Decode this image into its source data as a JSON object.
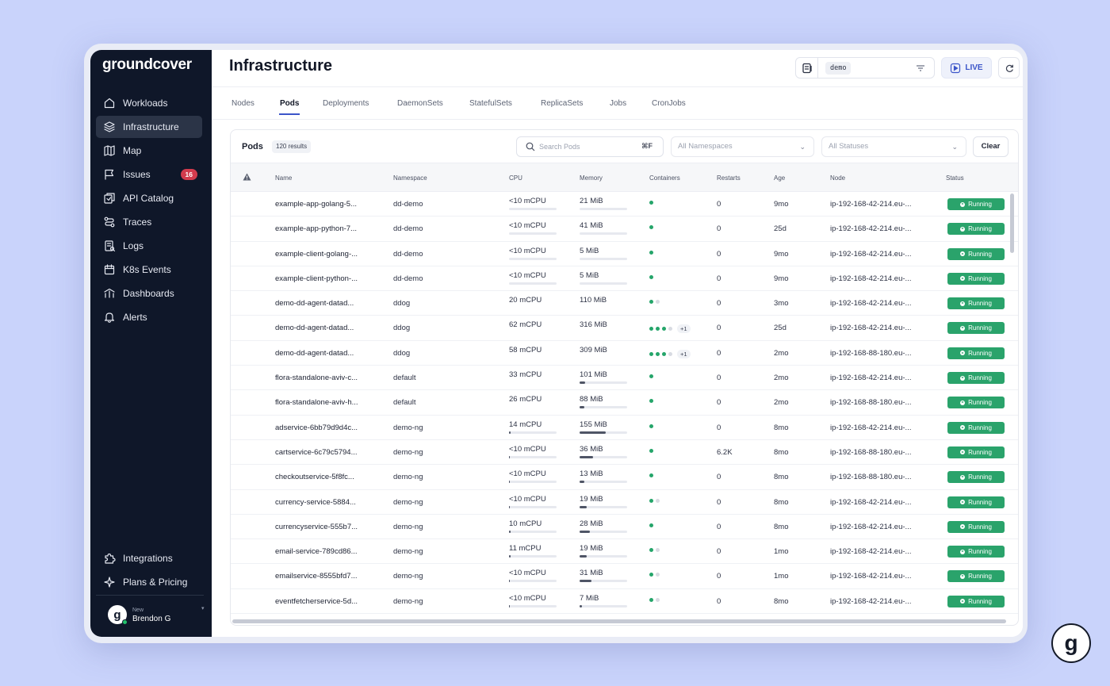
{
  "app": {
    "brand": "groundcover",
    "page_title": "Infrastructure"
  },
  "sidebar": {
    "items": [
      {
        "label": "Workloads",
        "icon": "home-icon"
      },
      {
        "label": "Infrastructure",
        "icon": "layers-icon",
        "active": true
      },
      {
        "label": "Map",
        "icon": "map-icon"
      },
      {
        "label": "Issues",
        "icon": "flag-icon",
        "badge": "16"
      },
      {
        "label": "API Catalog",
        "icon": "api-catalog-icon"
      },
      {
        "label": "Traces",
        "icon": "traces-icon"
      },
      {
        "label": "Logs",
        "icon": "logs-icon"
      },
      {
        "label": "K8s Events",
        "icon": "calendar-icon"
      },
      {
        "label": "Dashboards",
        "icon": "dashboards-icon"
      },
      {
        "label": "Alerts",
        "icon": "bell-icon"
      }
    ],
    "bottom_items": [
      {
        "label": "Integrations",
        "icon": "puzzle-icon"
      },
      {
        "label": "Plans & Pricing",
        "icon": "sparkle-icon"
      }
    ],
    "user": {
      "initial": "g",
      "tag": "New",
      "name": "Brendon G"
    }
  },
  "topbar": {
    "namespace_chip": "demo",
    "live_label": "LIVE"
  },
  "tabs": [
    "Nodes",
    "Pods",
    "Deployments",
    "DaemonSets",
    "StatefulSets",
    "ReplicaSets",
    "Jobs",
    "CronJobs"
  ],
  "active_tab": "Pods",
  "panel": {
    "title": "Pods",
    "results": "120 results",
    "search_placeholder": "Search Pods",
    "search_shortcut": "⌘F",
    "namespaces_placeholder": "All Namespaces",
    "statuses_placeholder": "All Statuses",
    "clear_label": "Clear"
  },
  "table": {
    "columns": [
      "Name",
      "Namespace",
      "CPU",
      "Memory",
      "Containers",
      "Restarts",
      "Age",
      "Node",
      "Status"
    ],
    "rows": [
      {
        "name": "example-app-golang-5...",
        "namespace": "dd-demo",
        "cpu": "<10 mCPU",
        "cpu_pct": 0,
        "memory": "21 MiB",
        "mem_pct": 0,
        "containers": [
          1
        ],
        "plus": "",
        "restarts": "0",
        "age": "9mo",
        "node": "ip-192-168-42-214.eu-...",
        "status": "Running"
      },
      {
        "name": "example-app-python-7...",
        "namespace": "dd-demo",
        "cpu": "<10 mCPU",
        "cpu_pct": 0,
        "memory": "41 MiB",
        "mem_pct": 0,
        "containers": [
          1
        ],
        "plus": "",
        "restarts": "0",
        "age": "25d",
        "node": "ip-192-168-42-214.eu-...",
        "status": "Running"
      },
      {
        "name": "example-client-golang-...",
        "namespace": "dd-demo",
        "cpu": "<10 mCPU",
        "cpu_pct": 0,
        "memory": "5 MiB",
        "mem_pct": 0,
        "containers": [
          1
        ],
        "plus": "",
        "restarts": "0",
        "age": "9mo",
        "node": "ip-192-168-42-214.eu-...",
        "status": "Running"
      },
      {
        "name": "example-client-python-...",
        "namespace": "dd-demo",
        "cpu": "<10 mCPU",
        "cpu_pct": 0,
        "memory": "5 MiB",
        "mem_pct": 0,
        "containers": [
          1
        ],
        "plus": "",
        "restarts": "0",
        "age": "9mo",
        "node": "ip-192-168-42-214.eu-...",
        "status": "Running"
      },
      {
        "name": "demo-dd-agent-datad...",
        "namespace": "ddog",
        "cpu": "20 mCPU",
        "memory": "110 MiB",
        "containers": [
          1,
          0
        ],
        "plus": "",
        "restarts": "0",
        "age": "3mo",
        "node": "ip-192-168-42-214.eu-...",
        "status": "Running"
      },
      {
        "name": "demo-dd-agent-datad...",
        "namespace": "ddog",
        "cpu": "62 mCPU",
        "memory": "316 MiB",
        "containers": [
          1,
          1,
          1,
          0
        ],
        "plus": "+1",
        "restarts": "0",
        "age": "25d",
        "node": "ip-192-168-42-214.eu-...",
        "status": "Running"
      },
      {
        "name": "demo-dd-agent-datad...",
        "namespace": "ddog",
        "cpu": "58 mCPU",
        "memory": "309 MiB",
        "containers": [
          1,
          1,
          1,
          0
        ],
        "plus": "+1",
        "restarts": "0",
        "age": "2mo",
        "node": "ip-192-168-88-180.eu-...",
        "status": "Running"
      },
      {
        "name": "flora-standalone-aviv-c...",
        "namespace": "default",
        "cpu": "33 mCPU",
        "memory": "101 MiB",
        "mem_pct": 12,
        "containers": [
          1
        ],
        "plus": "",
        "restarts": "0",
        "age": "2mo",
        "node": "ip-192-168-42-214.eu-...",
        "status": "Running"
      },
      {
        "name": "flora-standalone-aviv-h...",
        "namespace": "default",
        "cpu": "26 mCPU",
        "memory": "88 MiB",
        "mem_pct": 10,
        "containers": [
          1
        ],
        "plus": "",
        "restarts": "0",
        "age": "2mo",
        "node": "ip-192-168-88-180.eu-...",
        "status": "Running"
      },
      {
        "name": "adservice-6bb79d9d4c...",
        "namespace": "demo-ng",
        "cpu": "14 mCPU",
        "cpu_pct": 4,
        "memory": "155 MiB",
        "mem_pct": 55,
        "containers": [
          1
        ],
        "plus": "",
        "restarts": "0",
        "age": "8mo",
        "node": "ip-192-168-42-214.eu-...",
        "status": "Running"
      },
      {
        "name": "cartservice-6c79c5794...",
        "namespace": "demo-ng",
        "cpu": "<10 mCPU",
        "cpu_pct": 2,
        "memory": "36 MiB",
        "mem_pct": 28,
        "containers": [
          1
        ],
        "plus": "",
        "restarts": "6.2K",
        "age": "8mo",
        "node": "ip-192-168-88-180.eu-...",
        "status": "Running"
      },
      {
        "name": "checkoutservice-5f8fc...",
        "namespace": "demo-ng",
        "cpu": "<10 mCPU",
        "cpu_pct": 2,
        "memory": "13 MiB",
        "mem_pct": 10,
        "containers": [
          1
        ],
        "plus": "",
        "restarts": "0",
        "age": "8mo",
        "node": "ip-192-168-88-180.eu-...",
        "status": "Running"
      },
      {
        "name": "currency-service-5884...",
        "namespace": "demo-ng",
        "cpu": "<10 mCPU",
        "cpu_pct": 2,
        "memory": "19 MiB",
        "mem_pct": 15,
        "containers": [
          1,
          0
        ],
        "plus": "",
        "restarts": "0",
        "age": "8mo",
        "node": "ip-192-168-42-214.eu-...",
        "status": "Running"
      },
      {
        "name": "currencyservice-555b7...",
        "namespace": "demo-ng",
        "cpu": "10 mCPU",
        "cpu_pct": 3,
        "memory": "28 MiB",
        "mem_pct": 22,
        "containers": [
          1
        ],
        "plus": "",
        "restarts": "0",
        "age": "8mo",
        "node": "ip-192-168-42-214.eu-...",
        "status": "Running"
      },
      {
        "name": "email-service-789cd86...",
        "namespace": "demo-ng",
        "cpu": "11 mCPU",
        "cpu_pct": 3,
        "memory": "19 MiB",
        "mem_pct": 15,
        "containers": [
          1,
          0
        ],
        "plus": "",
        "restarts": "0",
        "age": "1mo",
        "node": "ip-192-168-42-214.eu-...",
        "status": "Running"
      },
      {
        "name": "emailservice-8555bfd7...",
        "namespace": "demo-ng",
        "cpu": "<10 mCPU",
        "cpu_pct": 2,
        "memory": "31 MiB",
        "mem_pct": 25,
        "containers": [
          1,
          0
        ],
        "plus": "",
        "restarts": "0",
        "age": "1mo",
        "node": "ip-192-168-42-214.eu-...",
        "status": "Running"
      },
      {
        "name": "eventfetcherservice-5d...",
        "namespace": "demo-ng",
        "cpu": "<10 mCPU",
        "cpu_pct": 2,
        "memory": "7 MiB",
        "mem_pct": 5,
        "containers": [
          1,
          0
        ],
        "plus": "",
        "restarts": "0",
        "age": "8mo",
        "node": "ip-192-168-42-214.eu-...",
        "status": "Running"
      }
    ]
  },
  "colors": {
    "sidebar_bg": "#0f1729",
    "accent": "#3b55c9",
    "running": "#2aa36b",
    "badge": "#d23b4d",
    "page_bg": "#c9d3fb"
  }
}
